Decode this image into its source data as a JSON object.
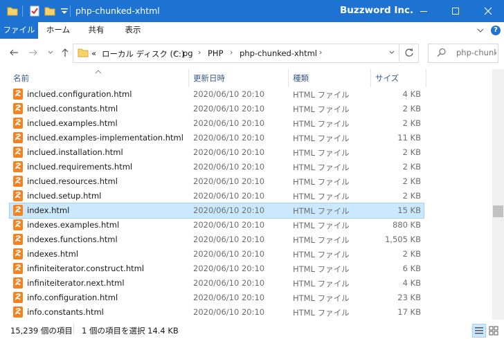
{
  "window": {
    "title": "php-chunked-xhtml",
    "brand": "Buzzword Inc."
  },
  "ribbon": {
    "tabs": [
      "ファイル",
      "ホーム",
      "共有",
      "表示"
    ]
  },
  "address": {
    "prefix": "«",
    "crumbs": [
      "ローカル ディスク (C:)",
      "pg",
      "PHP",
      "php-chunked-xhtml"
    ]
  },
  "search": {
    "placeholder": "php-chunk..."
  },
  "columns": {
    "name": "名前",
    "date": "更新日時",
    "type": "種類",
    "size": "サイズ"
  },
  "files": [
    {
      "name": "inclued.configuration.html",
      "date": "2020/06/10 20:10",
      "type": "HTML ファイル",
      "size": "4 KB"
    },
    {
      "name": "inclued.constants.html",
      "date": "2020/06/10 20:10",
      "type": "HTML ファイル",
      "size": "2 KB"
    },
    {
      "name": "inclued.examples.html",
      "date": "2020/06/10 20:10",
      "type": "HTML ファイル",
      "size": "2 KB"
    },
    {
      "name": "inclued.examples-implementation.html",
      "date": "2020/06/10 20:10",
      "type": "HTML ファイル",
      "size": "11 KB"
    },
    {
      "name": "inclued.installation.html",
      "date": "2020/06/10 20:10",
      "type": "HTML ファイル",
      "size": "2 KB"
    },
    {
      "name": "inclued.requirements.html",
      "date": "2020/06/10 20:10",
      "type": "HTML ファイル",
      "size": "2 KB"
    },
    {
      "name": "inclued.resources.html",
      "date": "2020/06/10 20:10",
      "type": "HTML ファイル",
      "size": "2 KB"
    },
    {
      "name": "inclued.setup.html",
      "date": "2020/06/10 20:10",
      "type": "HTML ファイル",
      "size": "2 KB"
    },
    {
      "name": "index.html",
      "date": "2020/06/10 20:10",
      "type": "HTML ファイル",
      "size": "15 KB",
      "selected": true
    },
    {
      "name": "indexes.examples.html",
      "date": "2020/06/10 20:10",
      "type": "HTML ファイル",
      "size": "880 KB"
    },
    {
      "name": "indexes.functions.html",
      "date": "2020/06/10 20:10",
      "type": "HTML ファイル",
      "size": "1,505 KB"
    },
    {
      "name": "indexes.html",
      "date": "2020/06/10 20:10",
      "type": "HTML ファイル",
      "size": "2 KB"
    },
    {
      "name": "infiniteiterator.construct.html",
      "date": "2020/06/10 20:10",
      "type": "HTML ファイル",
      "size": "6 KB"
    },
    {
      "name": "infiniteiterator.next.html",
      "date": "2020/06/10 20:10",
      "type": "HTML ファイル",
      "size": "4 KB"
    },
    {
      "name": "info.configuration.html",
      "date": "2020/06/10 20:10",
      "type": "HTML ファイル",
      "size": "23 KB"
    },
    {
      "name": "info.constants.html",
      "date": "2020/06/10 20:10",
      "type": "HTML ファイル",
      "size": "17 KB"
    }
  ],
  "status": {
    "count": "15,239 個の項目",
    "selection": "1 個の項目を選択  14.4 KB"
  },
  "colors": {
    "titlebar": "#1e73d2",
    "selection": "#cce8ff",
    "file_icon": "#f58220"
  }
}
